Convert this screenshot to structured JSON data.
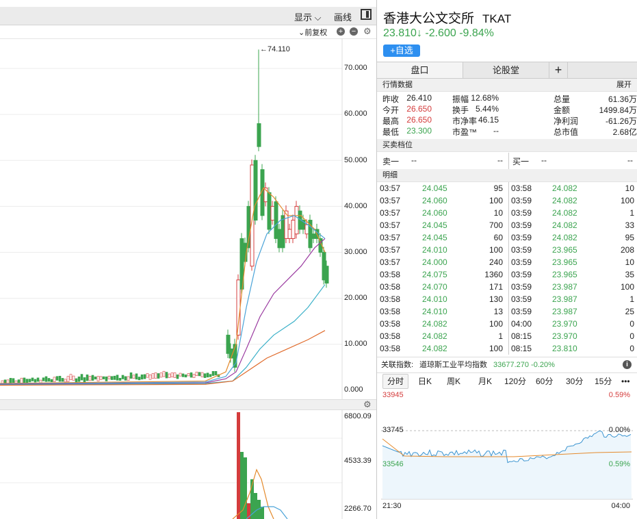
{
  "toolbar": {
    "display_label": "显示",
    "draw_label": "画线",
    "adjust_label": "前复权"
  },
  "price_axis": [
    "70.000",
    "60.000",
    "50.000",
    "40.000",
    "30.000",
    "20.000",
    "10.000",
    "0.000"
  ],
  "high_marker": "←74.110",
  "volume_axis": [
    "6800.09",
    "4533.39",
    "2266.70"
  ],
  "stock": {
    "name": "香港大公文交所",
    "ticker": "TKAT",
    "price": "23.810↓ -2.600 -9.84%",
    "watch_button": "+自选"
  },
  "tabs": {
    "pankou": "盘口",
    "forum": "论股堂",
    "add": "+"
  },
  "market_data": {
    "section_title": "行情数据",
    "expand_label": "展开",
    "rows": [
      [
        {
          "label": "昨收",
          "value": "26.410",
          "color": "normal"
        },
        {
          "label": "振幅",
          "value": "12.68%",
          "color": "normal"
        },
        {
          "label": "总量",
          "value": "61.36万",
          "color": "normal"
        }
      ],
      [
        {
          "label": "今开",
          "value": "26.650",
          "color": "red"
        },
        {
          "label": "换手",
          "value": "5.44%",
          "color": "normal"
        },
        {
          "label": "金额",
          "value": "1499.84万",
          "color": "normal"
        }
      ],
      [
        {
          "label": "最高",
          "value": "26.650",
          "color": "red"
        },
        {
          "label": "市净率",
          "value": "46.15",
          "color": "normal"
        },
        {
          "label": "净利润",
          "value": "-61.26万",
          "color": "normal"
        }
      ],
      [
        {
          "label": "最低",
          "value": "23.300",
          "color": "green"
        },
        {
          "label": "市盈™",
          "value": "--",
          "color": "normal"
        },
        {
          "label": "总市值",
          "value": "2.68亿",
          "color": "normal"
        }
      ]
    ]
  },
  "order_book": {
    "section_title": "买卖档位",
    "sell1_label": "卖一",
    "sell1_price": "--",
    "sell1_vol": "--",
    "buy1_label": "买一",
    "buy1_price": "--",
    "buy1_vol": "--"
  },
  "trades": {
    "section_title": "明细",
    "left": [
      [
        "03:57",
        "24.045",
        "95"
      ],
      [
        "03:57",
        "24.060",
        "100"
      ],
      [
        "03:57",
        "24.060",
        "10"
      ],
      [
        "03:57",
        "24.045",
        "700"
      ],
      [
        "03:57",
        "24.045",
        "60"
      ],
      [
        "03:57",
        "24.010",
        "100"
      ],
      [
        "03:57",
        "24.000",
        "240"
      ],
      [
        "03:58",
        "24.075",
        "1360"
      ],
      [
        "03:58",
        "24.070",
        "171"
      ],
      [
        "03:58",
        "24.010",
        "130"
      ],
      [
        "03:58",
        "24.010",
        "13"
      ],
      [
        "03:58",
        "24.082",
        "100"
      ],
      [
        "03:58",
        "24.082",
        "1"
      ],
      [
        "03:58",
        "24.082",
        "100"
      ]
    ],
    "right": [
      [
        "03:58",
        "24.082",
        "10"
      ],
      [
        "03:59",
        "24.082",
        "100"
      ],
      [
        "03:59",
        "24.082",
        "1"
      ],
      [
        "03:59",
        "24.082",
        "33"
      ],
      [
        "03:59",
        "24.082",
        "95"
      ],
      [
        "03:59",
        "23.965",
        "208"
      ],
      [
        "03:59",
        "23.965",
        "10"
      ],
      [
        "03:59",
        "23.965",
        "35"
      ],
      [
        "03:59",
        "23.987",
        "100"
      ],
      [
        "03:59",
        "23.987",
        "1"
      ],
      [
        "03:59",
        "23.987",
        "25"
      ],
      [
        "04:00",
        "23.970",
        "0"
      ],
      [
        "08:15",
        "23.970",
        "0"
      ],
      [
        "08:15",
        "23.810",
        "0"
      ]
    ]
  },
  "index": {
    "label": "关联指数:",
    "name": "道琼斯工业平均指数",
    "value": "33677.270 -0.20%"
  },
  "periods": [
    "分时",
    "日K",
    "周K",
    "月K",
    "120分",
    "60分",
    "30分",
    "15分",
    "•••"
  ],
  "mini_chart": {
    "y_top": "33945",
    "y_mid": "33745",
    "y_bot": "33546",
    "pct_top": "0.59%",
    "pct_mid": "0.00%",
    "pct_bot": "0.59%",
    "x_start": "21:30",
    "x_end": "04:00"
  },
  "colors": {
    "up": "#d43c3c",
    "down": "#3ba44f",
    "accent": "#2d8ff0"
  }
}
